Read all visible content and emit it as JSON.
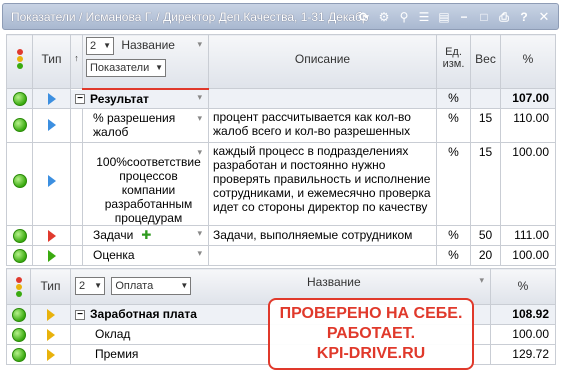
{
  "window": {
    "title": "Показатели / Исманова Г. / Директор Деп.Качества, 1-31 Декабр"
  },
  "table1": {
    "headers": {
      "type": "Тип",
      "level": "2",
      "name": "Название",
      "filter": "Показатели",
      "description": "Описание",
      "unit": "Ед. изм.",
      "weight": "Вес",
      "percent": "%"
    },
    "rows": [
      {
        "name": "Результат",
        "description": "",
        "unit": "%",
        "weight": "",
        "percent": "107.00",
        "bold": true,
        "icon": "blue"
      },
      {
        "name": "% разрешения жалоб",
        "description": "процент рассчитывается как кол-во жалоб всего и кол-во разрешенных",
        "unit": "%",
        "weight": "15",
        "percent": "110.00",
        "icon": "blue"
      },
      {
        "name": "100%соответствие процессов компании разработанным процедурам",
        "description": "каждый процесс в подразделениях разработан и постоянно нужно проверять правильность и исполнение сотрудниками, и ежемесячно проверка идет со стороны директор по качеству",
        "unit": "%",
        "weight": "15",
        "percent": "100.00",
        "icon": "blue"
      },
      {
        "name": "Задачи",
        "description": "Задачи, выполняемые сотрудником",
        "unit": "%",
        "weight": "50",
        "percent": "111.00",
        "icon": "red"
      },
      {
        "name": "Оценка",
        "description": "",
        "unit": "%",
        "weight": "20",
        "percent": "100.00",
        "icon": "green"
      }
    ]
  },
  "table2": {
    "headers": {
      "type": "Тип",
      "level": "2",
      "filter": "Оплата",
      "name": "Название",
      "percent": "%"
    },
    "rows": [
      {
        "name": "Заработная плата",
        "percent": "108.92",
        "bold": true
      },
      {
        "name": "Оклад",
        "percent": "100.00"
      },
      {
        "name": "Премия",
        "percent": "129.72"
      }
    ]
  },
  "stamp": {
    "line1": "ПРОВЕРЕНО НА СЕБЕ.",
    "line2": "РАБОТАЕТ.",
    "line3": "KPI-DRIVE.RU"
  },
  "colors": {
    "accent_red": "#e0392b",
    "ok_green": "#3aaa10",
    "titlebar": "#a9b8d0"
  }
}
